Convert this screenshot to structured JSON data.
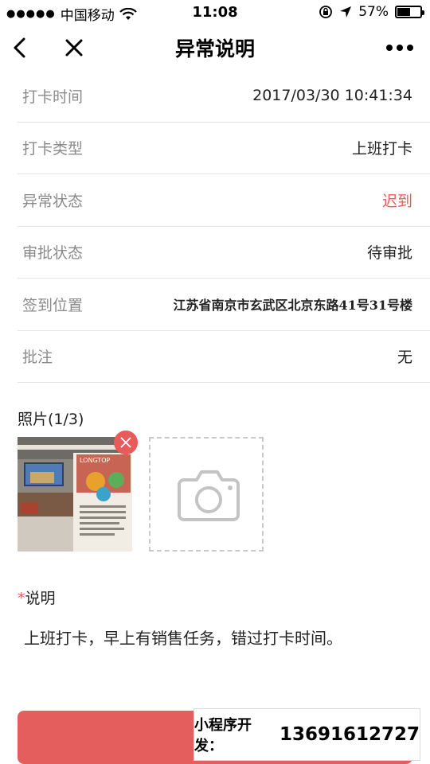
{
  "status_bar": {
    "signal_dots": "●●●●●",
    "carrier": "中国移动",
    "wifi_icon": "wifi-icon",
    "time": "11:08",
    "battery_text": "57%",
    "battery_level": 0.57
  },
  "nav": {
    "title": "异常说明",
    "back_icon": "back-chevron-icon",
    "close_icon": "close-icon",
    "more_icon": "more-dots-icon"
  },
  "rows": [
    {
      "label": "打卡时间",
      "value": "2017/03/30 10:41:34"
    },
    {
      "label": "打卡类型",
      "value": "上班打卡"
    },
    {
      "label": "异常状态",
      "value": "迟到"
    },
    {
      "label": "审批状态",
      "value": "待审批"
    },
    {
      "label": "签到位置",
      "value": "江苏省南京市玄武区北京东路41号31号楼"
    },
    {
      "label": "批注",
      "value": "无"
    }
  ],
  "photos": {
    "title": "照片(1/3)",
    "poster_brand": "LONGTOP",
    "remove_icon": "close-icon",
    "add_icon": "camera-icon"
  },
  "description": {
    "required_mark": "*",
    "label": "说明",
    "text": "上班打卡，早上有销售任务，错过打卡时间。"
  },
  "promo": {
    "label": "小程序开发：",
    "phone": "13691612727"
  },
  "colors": {
    "accent_red": "#e95b5b",
    "button_red": "#e55e5e",
    "divider": "#e3e3e3",
    "label_gray": "#8a8a8a"
  }
}
